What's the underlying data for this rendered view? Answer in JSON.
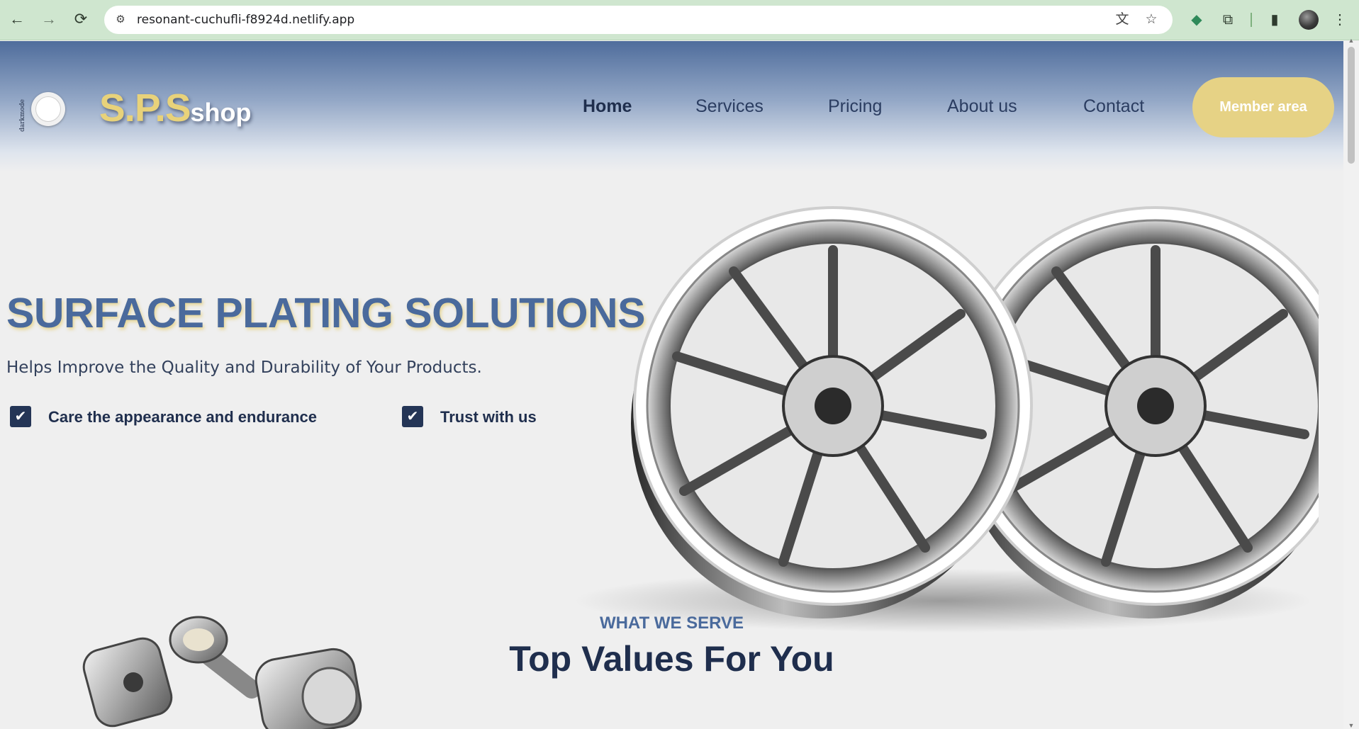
{
  "browser": {
    "back_icon": "←",
    "forward_icon": "→",
    "reload_icon": "⟳",
    "site_info_icon": "⚙",
    "url": "resonant-cuchufli-f8924d.netlify.app",
    "translate_icon": "文",
    "bookmark_icon": "☆",
    "extension_leaf_icon": "◆",
    "extensions_icon": "⧉",
    "sidepanel_icon": "▮",
    "menu_icon": "⋮"
  },
  "header": {
    "darkmode_label": "darkmode",
    "logo_main": "S.P.S",
    "logo_sub": "shop",
    "nav": [
      {
        "label": "Home"
      },
      {
        "label": "Services"
      },
      {
        "label": "Pricing"
      },
      {
        "label": "About us"
      },
      {
        "label": "Contact"
      }
    ],
    "member_button": "Member area"
  },
  "hero": {
    "title": "SURFACE PLATING SOLUTIONS",
    "subtitle": "Helps Improve the Quality and Durability of Your Products.",
    "checks": [
      {
        "label": "Care the appearance and endurance"
      },
      {
        "label": "Trust with us"
      }
    ],
    "check_icon": "✔"
  },
  "section": {
    "kicker": "WHAT WE SERVE",
    "title": "Top Values For You"
  },
  "colors": {
    "accent_gold": "#e6d285",
    "brand_blue": "#4a6a9c",
    "navy": "#1f2e4d"
  }
}
